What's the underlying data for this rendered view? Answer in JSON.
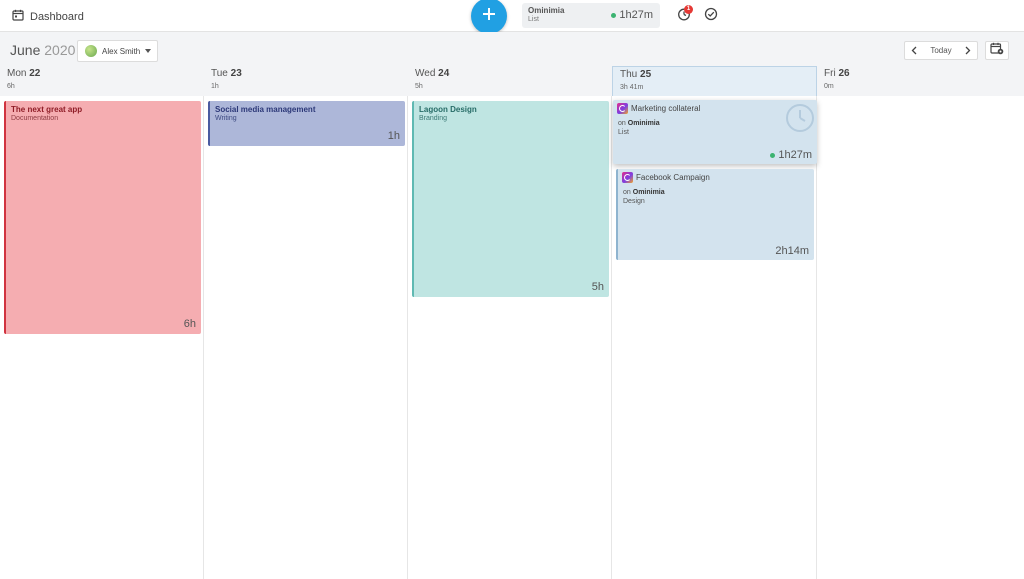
{
  "topbar": {
    "dashboard_label": "Dashboard",
    "timer": {
      "project": "Ominimia",
      "list": "List",
      "time": "1h27m"
    },
    "notification_count": "1",
    "accent_color": "#21a0e3"
  },
  "subheader": {
    "month": "June",
    "year": "2020",
    "user": "Alex Smith",
    "today_label": "Today"
  },
  "days": [
    {
      "dow": "Mon",
      "date": "22",
      "total": "6h"
    },
    {
      "dow": "Tue",
      "date": "23",
      "total": "1h"
    },
    {
      "dow": "Wed",
      "date": "24",
      "total": "5h"
    },
    {
      "dow": "Thu",
      "date": "25",
      "total": "3h 41m"
    },
    {
      "dow": "Fri",
      "date": "26",
      "total": "0m"
    }
  ],
  "events": [
    {
      "title": "The next great app",
      "subtitle": "Documentation",
      "duration": "6h",
      "color": "#f5adb1",
      "accent": "#d0333f"
    },
    {
      "title": "Social media management",
      "subtitle": "Writing",
      "duration": "1h",
      "color": "#adb7d9",
      "accent": "#4a5ba0"
    },
    {
      "title": "Lagoon Design",
      "subtitle": "Branding",
      "duration": "5h",
      "color": "#bfe5e2",
      "accent": "#5fb9b2"
    }
  ],
  "tasks": [
    {
      "title": "Marketing collateral",
      "on_prefix": "on",
      "project": "Ominimia",
      "list": "List",
      "duration": "1h27m"
    },
    {
      "title": "Facebook Campaign",
      "on_prefix": "on",
      "project": "Ominimia",
      "list": "Design",
      "duration": "2h14m"
    }
  ]
}
